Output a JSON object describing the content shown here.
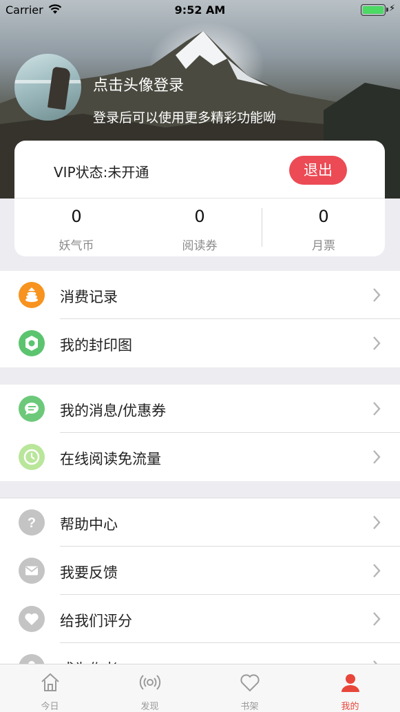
{
  "status_bar": {
    "carrier": "Carrier",
    "time": "9:52 AM"
  },
  "profile": {
    "login_prompt": "点击头像登录",
    "login_subtitle": "登录后可以使用更多精彩功能呦"
  },
  "account_card": {
    "vip_status": "VIP状态:未开通",
    "logout_label": "退出",
    "stats": [
      {
        "value": "0",
        "label": "妖气币"
      },
      {
        "value": "0",
        "label": "阅读券"
      },
      {
        "value": "0",
        "label": "月票"
      }
    ]
  },
  "menu": {
    "group1": [
      {
        "label": "消费记录",
        "icon": "coins-icon",
        "color": "#f7931e"
      },
      {
        "label": "我的封印图",
        "icon": "seal-icon",
        "color": "#5cc46f"
      }
    ],
    "group2": [
      {
        "label": "我的消息/优惠券",
        "icon": "message-icon",
        "color": "#6cc97a"
      },
      {
        "label": "在线阅读免流量",
        "icon": "clock-icon",
        "color": "#b9e69a"
      }
    ],
    "group3": [
      {
        "label": "帮助中心",
        "icon": "question-icon",
        "color": "#c4c4c4"
      },
      {
        "label": "我要反馈",
        "icon": "mail-icon",
        "color": "#c4c4c4"
      },
      {
        "label": "给我们评分",
        "icon": "heart-icon",
        "color": "#c4c4c4"
      },
      {
        "label": "成为作者",
        "icon": "author-icon",
        "color": "#c4c4c4"
      }
    ]
  },
  "tabbar": {
    "tabs": [
      {
        "label": "今日",
        "icon": "home-icon"
      },
      {
        "label": "发现",
        "icon": "broadcast-icon"
      },
      {
        "label": "书架",
        "icon": "heart-outline-icon"
      },
      {
        "label": "我的",
        "icon": "person-icon"
      }
    ],
    "active_color": "#e8463a"
  }
}
